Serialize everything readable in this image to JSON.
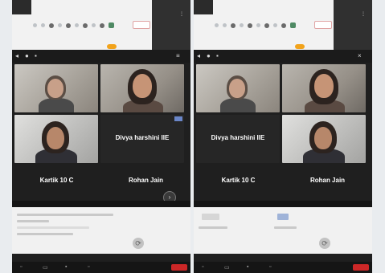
{
  "left_panel": {
    "tiles": [
      {
        "label": ""
      },
      {
        "label": ""
      },
      {
        "label": ""
      },
      {
        "label": "Divya harshini IIE"
      }
    ],
    "names_row": {
      "left": "Kartik 10 C",
      "right": "Rohan Jain"
    }
  },
  "right_panel": {
    "tiles": [
      {
        "label": ""
      },
      {
        "label": ""
      },
      {
        "label": "Divya harshini IIE"
      },
      {
        "label": ""
      }
    ],
    "names_row": {
      "left": "Kartik 10 C",
      "right": "Rohan Jain"
    }
  },
  "icons": {
    "more": "⋮",
    "close": "×",
    "mic": "●",
    "arrow": "›"
  }
}
